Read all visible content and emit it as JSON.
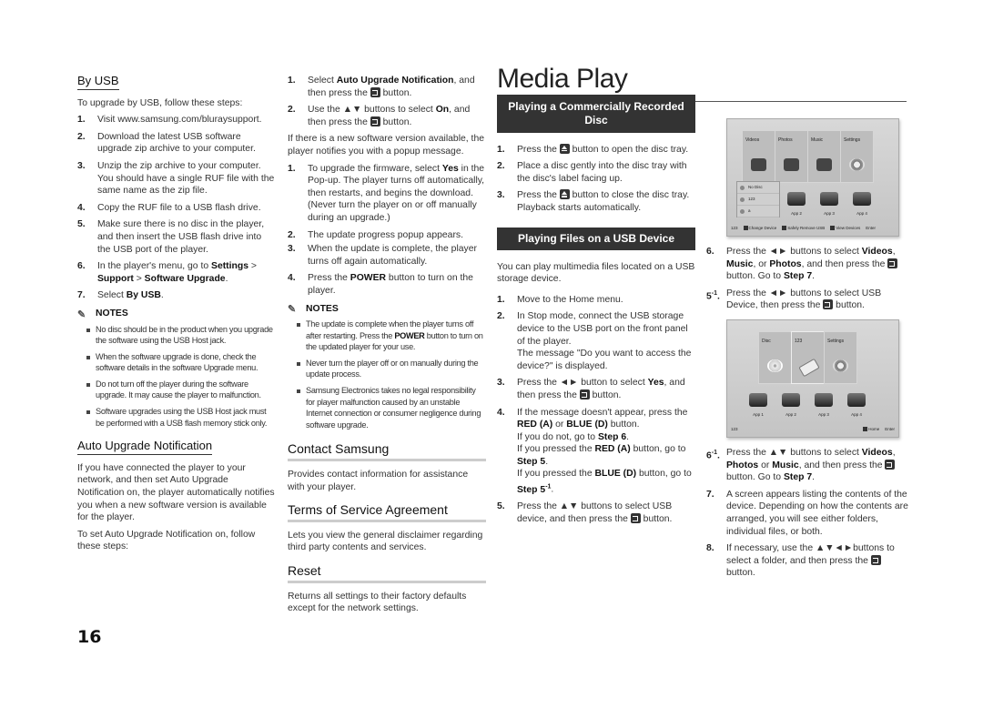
{
  "page_number": "16",
  "col1": {
    "by_usb": {
      "heading": "By USB",
      "intro": "To upgrade by USB, follow these steps:",
      "steps": [
        {
          "num": "1.",
          "text": "Visit www.samsung.com/bluraysupport."
        },
        {
          "num": "2.",
          "text": "Download the latest USB software upgrade zip archive to your computer."
        },
        {
          "num": "3.",
          "text": "Unzip the zip archive to your computer. You should have a single RUF file with the same name as the zip file."
        },
        {
          "num": "4.",
          "text": "Copy the RUF file to a USB flash drive."
        },
        {
          "num": "5.",
          "text": "Make sure there is no disc in the player, and then insert the USB flash drive into the USB port of the player."
        },
        {
          "num": "6.",
          "pre": "In the player's menu, go to ",
          "b1": "Settings",
          "mid1": " > ",
          "b2": "Support",
          "mid2": " > ",
          "b3": "Software Upgrade",
          "post": "."
        },
        {
          "num": "7.",
          "pre": "Select ",
          "b1": "By USB",
          "post": "."
        }
      ],
      "notes_label": "NOTES",
      "notes": [
        "No disc should be in the product when you upgrade the software using the USB Host jack.",
        "When the software upgrade is done, check the software details in the software Upgrade menu.",
        "Do not turn off the player during the software upgrade. It may cause the player to malfunction.",
        "Software upgrades using the USB Host jack must be performed with a USB flash memory stick only."
      ]
    },
    "auto_upgrade": {
      "heading": "Auto Upgrade Notification",
      "p1": "If you have connected the player to your network, and then set Auto Upgrade Notification on, the player automatically notifies you when a new software version is available for the player.",
      "p2": "To set Auto Upgrade Notification on, follow these steps:"
    }
  },
  "col2": {
    "steps_a": [
      {
        "num": "1.",
        "pre": "Select ",
        "b1": "Auto Upgrade Notification",
        "mid": ", and then press the ",
        "post": " button."
      },
      {
        "num": "2.",
        "pre": "Use the ▲▼ buttons to select ",
        "b1": "On",
        "mid": ", and then press the ",
        "post": " button."
      }
    ],
    "popup_text": "If there is a new software version available, the player notifies you with a popup message.",
    "steps_b": [
      {
        "num": "1.",
        "pre": "To upgrade the firmware, select ",
        "b1": "Yes",
        "post": " in the Pop-up. The player turns off automatically, then restarts, and begins the download. (Never turn the player on or off manually during an upgrade.)"
      },
      {
        "num": "2.",
        "pre": "The update progress popup appears.",
        "b1": "",
        "post": ""
      },
      {
        "num": "3.",
        "pre": "When the update is complete, the player turns off again automatically.",
        "b1": "",
        "post": ""
      },
      {
        "num": "4.",
        "pre": "Press the ",
        "b1": "POWER",
        "post": " button to turn on the player."
      }
    ],
    "notes_label": "NOTES",
    "notes": [
      {
        "pre": "The update is complete when the player turns off after restarting. Press the ",
        "b": "POWER",
        "post": " button to turn on the updated player for your use."
      },
      {
        "pre": "Never turn the player off or on manually during the update process.",
        "b": "",
        "post": ""
      },
      {
        "pre": "Samsung Electronics takes no legal responsibility for player malfunction caused by an unstable Internet connection or consumer negligence during software upgrade.",
        "b": "",
        "post": ""
      }
    ],
    "contact": {
      "heading": "Contact Samsung",
      "text": "Provides contact information for assistance with your player."
    },
    "terms": {
      "heading": "Terms of Service Agreement",
      "text": "Lets you view the general disclaimer regarding third party contents and services."
    },
    "reset": {
      "heading": "Reset",
      "text": "Returns all settings to their factory defaults except for the network settings."
    }
  },
  "col3": {
    "title": "Media Play",
    "disc_banner": "Playing a Commercially Recorded Disc",
    "disc_steps": [
      {
        "num": "1.",
        "pre": "Press the ",
        "post": " button to open the disc tray."
      },
      {
        "num": "2.",
        "pre": "Place a disc gently into the disc tray with the disc's label facing up.",
        "post": ""
      },
      {
        "num": "3.",
        "pre": "Press the ",
        "post": " button to close the disc tray. Playback starts automatically."
      }
    ],
    "usb_banner": "Playing Files on a USB Device",
    "usb_intro": "You can play multimedia files located on a USB storage device.",
    "usb_steps": {
      "s1": {
        "num": "1.",
        "text": "Move to the Home menu."
      },
      "s2": {
        "num": "2.",
        "text": "In Stop mode, connect the USB storage device to the USB port on the front panel of the player.",
        "text2": "The message \"Do you want to access the device?\" is displayed."
      },
      "s3": {
        "num": "3.",
        "pre": "Press the ◄► button to select ",
        "b": "Yes",
        "mid": ", and then press the ",
        "post": " button."
      },
      "s4": {
        "num": "4.",
        "l1_pre": "If the message doesn't appear, press the ",
        "l1_b1": "RED (A)",
        "l1_mid": " or ",
        "l1_b2": "BLUE (D)",
        "l1_post": " button.",
        "l2_pre": "If you do not, go to ",
        "l2_b": "Step 6",
        "l2_post": ".",
        "l3_pre": "If you pressed the ",
        "l3_b1": "RED (A)",
        "l3_mid": " button, go to ",
        "l3_b2": "Step 5",
        "l3_post": ".",
        "l4_pre": "If you pressed the ",
        "l4_b1": "BLUE (D)",
        "l4_mid": " button, go to ",
        "l4_b2": "Step 5",
        "l4_sup": "-1",
        "l4_post": "."
      },
      "s5": {
        "num": "5.",
        "pre": "Press the ▲▼ buttons to select USB device, and then press the ",
        "post": " button."
      }
    }
  },
  "col4": {
    "screen1": {
      "tiles": [
        "Videos",
        "Photos",
        "Music",
        "Settings"
      ],
      "popup_items": [
        "No Disc",
        "123",
        "a"
      ],
      "apps": [
        "App 2",
        "App 3",
        "App 4"
      ],
      "bar": {
        "device": "123",
        "a": "Change Device",
        "b": "Safely Remove USB",
        "c": "View Devices",
        "enter": "Enter"
      }
    },
    "step6": {
      "num": "6.",
      "pre": "Press the ◄► buttons to select ",
      "b1": "Videos",
      "m1": ", ",
      "b2": "Music",
      "m2": ", or ",
      "b3": "Photos",
      "m3": ", and then press the ",
      "m4": " button. Go to ",
      "b4": "Step 7",
      "post": "."
    },
    "step5_1": {
      "num": "5",
      "sup": "-1",
      "dot": ".",
      "pre": "Press the ◄► buttons to select USB Device, then press the ",
      "post": " button."
    },
    "screen2": {
      "tiles": [
        "Disc",
        "123",
        "Settings"
      ],
      "apps": [
        "App 1",
        "App 2",
        "App 3",
        "App 4"
      ],
      "bar": {
        "device": "123",
        "home": "Home",
        "enter": "Enter"
      }
    },
    "step6_1": {
      "num": "6",
      "sup": "-1",
      "dot": ".",
      "pre": "Press the ▲▼ buttons to select ",
      "b1": "Videos",
      "m1": ", ",
      "b2": "Photos",
      "m2": " or ",
      "b3": "Music",
      "m3": ", and then press the ",
      "m4": " button. Go to ",
      "b4": "Step 7",
      "post": "."
    },
    "step7": {
      "num": "7.",
      "text": "A screen appears listing the contents of the device. Depending on how the contents are arranged, you will see either folders, individual files, or both."
    },
    "step8": {
      "num": "8.",
      "pre": "If necessary, use the ▲▼◄►buttons to select a folder, and then press the ",
      "post": " button."
    }
  }
}
